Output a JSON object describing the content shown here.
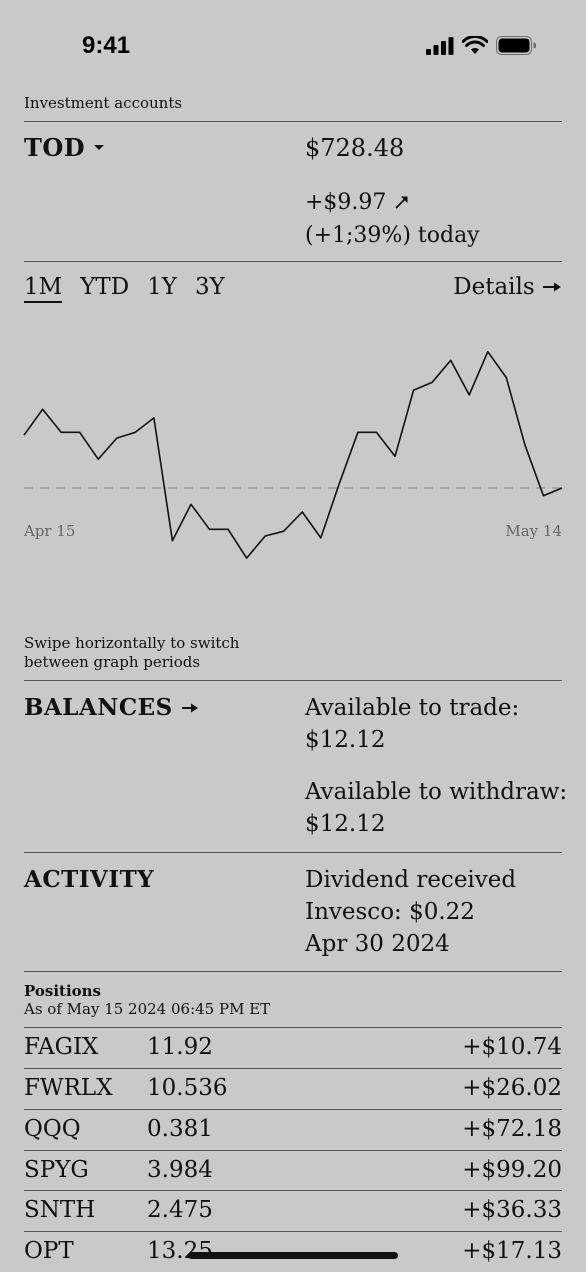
{
  "status": {
    "time": "9:41"
  },
  "accounts": {
    "section_title": "Investment accounts",
    "name": "TOD",
    "value": "$728.48",
    "change": "+$9.97",
    "change_pct": "(+1;39%) today"
  },
  "chart": {
    "tabs": [
      "1M",
      "YTD",
      "1Y",
      "3Y"
    ],
    "active_tab": "1M",
    "details": "Details",
    "start_label": "Apr 15",
    "end_label": "May 14",
    "hint": "Swipe horizontally to switch between graph periods"
  },
  "chart_data": {
    "type": "line",
    "x": [
      "Apr 15",
      "",
      "",
      "",
      "",
      "",
      "",
      "",
      "",
      "",
      "",
      "",
      "",
      "",
      "",
      "",
      "",
      "",
      "",
      "",
      "",
      "",
      "",
      "",
      "",
      "",
      "",
      "",
      "",
      "May 14"
    ],
    "values": [
      0.55,
      0.82,
      0.58,
      0.58,
      0.3,
      0.52,
      0.58,
      0.73,
      -0.55,
      -0.17,
      -0.43,
      -0.43,
      -0.73,
      -0.5,
      -0.45,
      -0.25,
      -0.52,
      0.05,
      0.58,
      0.58,
      0.33,
      1.02,
      1.1,
      1.33,
      0.97,
      1.42,
      1.15,
      0.45,
      -0.08,
      0.0
    ],
    "baseline": 0,
    "grid": false,
    "legend": "none"
  },
  "balances": {
    "title": "BALANCES",
    "trade_label": "Available to trade:",
    "trade_value": "$12.12",
    "withdraw_label": "Available to withdraw:",
    "withdraw_value": "$12.12"
  },
  "activity": {
    "title": "ACTIVITY",
    "line1": "Dividend received",
    "line2": "Invesco: $0.22",
    "line3": "Apr 30 2024"
  },
  "positions": {
    "title": "Positions",
    "as_of": "As of May 15 2024 06:45 PM ET",
    "rows": [
      {
        "symbol": "FAGIX",
        "qty": "11.92",
        "gain": "+$10.74"
      },
      {
        "symbol": "FWRLX",
        "qty": "10.536",
        "gain": "+$26.02"
      },
      {
        "symbol": "QQQ",
        "qty": "0.381",
        "gain": "+$72.18"
      },
      {
        "symbol": "SPYG",
        "qty": "3.984",
        "gain": "+$99.20"
      },
      {
        "symbol": "SNTH",
        "qty": "2.475",
        "gain": "+$36.33"
      },
      {
        "symbol": "OPT",
        "qty": "13.25",
        "gain": "+$17.13"
      }
    ]
  }
}
